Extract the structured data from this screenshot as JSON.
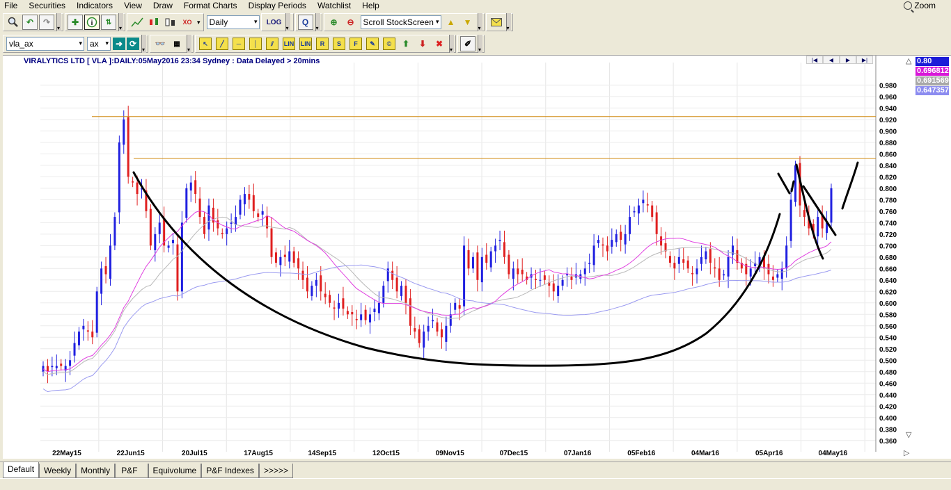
{
  "menu": [
    "File",
    "Securities",
    "Indicators",
    "View",
    "Draw",
    "Format Charts",
    "Display Periods",
    "Watchlist",
    "Help"
  ],
  "zoom_label": "Zoom",
  "toolbar1": {
    "period_select": "Daily",
    "log_label": "LOG",
    "scroll_select": "Scroll StockScreen"
  },
  "toolbar2": {
    "security_select": "vla_ax",
    "exchange_select": "ax",
    "draw_tools": [
      "LIN",
      "LIN",
      "R",
      "S",
      "F"
    ]
  },
  "chart": {
    "title": "VIRALYTICS LTD [ VLA ]:DAILY:05May2016 23:34 Sydney : Data Delayed > 20mins",
    "price_tags": [
      {
        "value": "0.80",
        "bg": "#1c1cd8",
        "fg": "#ffffff"
      },
      {
        "value": "0.696812",
        "bg": "#d818d8",
        "fg": "#ffffff"
      },
      {
        "value": "0.691569",
        "bg": "#a8a8a8",
        "fg": "#ffffff"
      },
      {
        "value": "0.647357",
        "bg": "#8c8cf0",
        "fg": "#ffffff"
      }
    ]
  },
  "chart_data": {
    "type": "candlestick",
    "title": "VIRALYTICS LTD [ VLA ]:DAILY:05May2016 23:34 Sydney : Data Delayed > 20mins",
    "ylim": [
      0.35,
      0.995
    ],
    "yticks": [
      "0.980",
      "0.960",
      "0.940",
      "0.920",
      "0.900",
      "0.880",
      "0.860",
      "0.840",
      "0.820",
      "0.800",
      "0.780",
      "0.760",
      "0.740",
      "0.720",
      "0.700",
      "0.680",
      "0.660",
      "0.640",
      "0.620",
      "0.600",
      "0.580",
      "0.560",
      "0.540",
      "0.520",
      "0.500",
      "0.480",
      "0.460",
      "0.440",
      "0.420",
      "0.400",
      "0.380",
      "0.360"
    ],
    "xticks": [
      "22May15",
      "22Jun15",
      "20Jul15",
      "17Aug15",
      "14Sep15",
      "12Oct15",
      "09Nov15",
      "07Dec15",
      "07Jan16",
      "05Feb16",
      "04Mar16",
      "05Apr16",
      "04May16"
    ],
    "horizontal_lines": [
      0.925,
      0.852
    ],
    "colors": {
      "up": "#2020e0",
      "down": "#e02020",
      "ma_fast": "#e040e0",
      "ma_mid": "#b8b8b8",
      "ma_slow": "#9a9af0",
      "hline": "#d08a10",
      "drawn": "#000000"
    },
    "closes": [
      0.49,
      0.48,
      0.49,
      0.49,
      0.49,
      0.49,
      0.5,
      0.53,
      0.55,
      0.56,
      0.55,
      0.54,
      0.62,
      0.66,
      0.65,
      0.7,
      0.75,
      0.88,
      0.92,
      0.82,
      0.81,
      0.79,
      0.8,
      0.76,
      0.7,
      0.72,
      0.74,
      0.7,
      0.7,
      0.71,
      0.62,
      0.74,
      0.8,
      0.81,
      0.79,
      0.75,
      0.72,
      0.77,
      0.74,
      0.73,
      0.72,
      0.73,
      0.74,
      0.75,
      0.78,
      0.79,
      0.78,
      0.76,
      0.75,
      0.76,
      0.73,
      0.68,
      0.67,
      0.68,
      0.68,
      0.69,
      0.67,
      0.66,
      0.64,
      0.62,
      0.63,
      0.64,
      0.62,
      0.61,
      0.6,
      0.59,
      0.6,
      0.59,
      0.58,
      0.58,
      0.57,
      0.58,
      0.57,
      0.58,
      0.59,
      0.6,
      0.63,
      0.66,
      0.64,
      0.62,
      0.63,
      0.6,
      0.56,
      0.55,
      0.53,
      0.55,
      0.56,
      0.57,
      0.55,
      0.54,
      0.56,
      0.58,
      0.6,
      0.59,
      0.7,
      0.66,
      0.68,
      0.64,
      0.68,
      0.67,
      0.69,
      0.7,
      0.71,
      0.68,
      0.65,
      0.66,
      0.65,
      0.65,
      0.64,
      0.65,
      0.64,
      0.64,
      0.64,
      0.63,
      0.62,
      0.63,
      0.64,
      0.65,
      0.64,
      0.65,
      0.65,
      0.66,
      0.67,
      0.7,
      0.71,
      0.7,
      0.69,
      0.71,
      0.72,
      0.71,
      0.72,
      0.75,
      0.76,
      0.77,
      0.78,
      0.77,
      0.75,
      0.72,
      0.7,
      0.69,
      0.67,
      0.66,
      0.68,
      0.67,
      0.66,
      0.65,
      0.66,
      0.68,
      0.69,
      0.67,
      0.66,
      0.64,
      0.65,
      0.68,
      0.7,
      0.67,
      0.66,
      0.65,
      0.66,
      0.67,
      0.68,
      0.66,
      0.65,
      0.64,
      0.65,
      0.66,
      0.7,
      0.78,
      0.84,
      0.77,
      0.75,
      0.73,
      0.72,
      0.75,
      0.73,
      0.74,
      0.8
    ]
  },
  "bottom_tabs": [
    "Default",
    "Weekly",
    "Monthly",
    "P&F",
    "Equivolume",
    "P&F Indexes",
    ">>>>>"
  ]
}
